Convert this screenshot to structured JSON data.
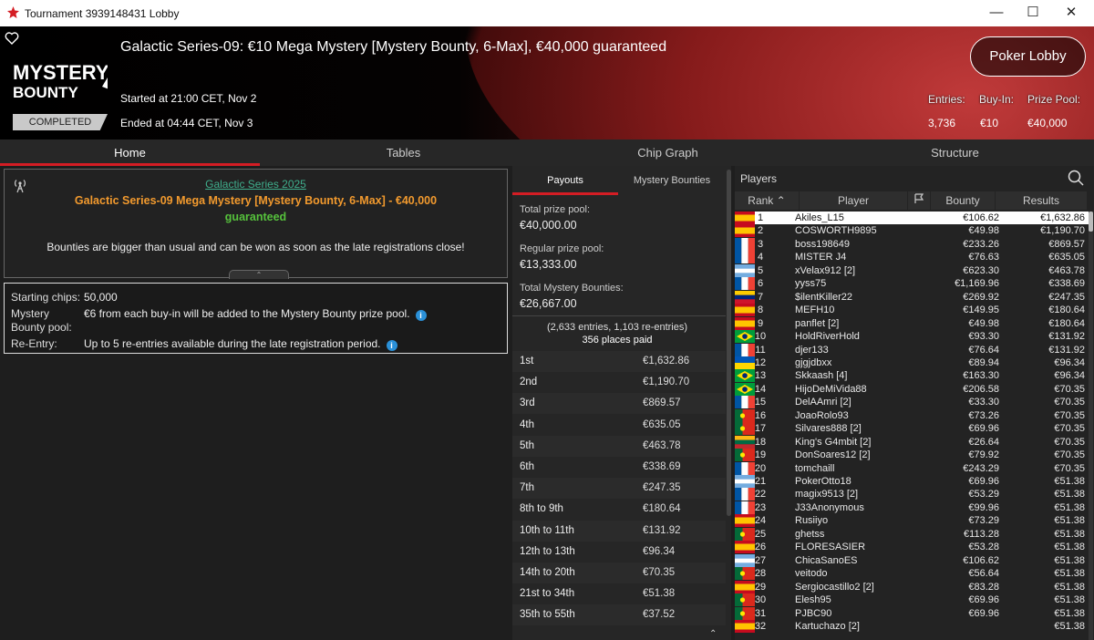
{
  "window": {
    "title": "Tournament 3939148431 Lobby"
  },
  "header": {
    "tournament_title": "Galactic Series-09: €10 Mega Mystery [Mystery Bounty, 6-Max], €40,000 guaranteed",
    "started": "Started at 21:00 CET, Nov 2",
    "ended": "Ended at 04:44 CET, Nov 3",
    "status_badge": "COMPLETED",
    "logo_text_top": "MYSTERY",
    "logo_text_bottom": "BOUNTY",
    "lobby_button": "Poker Lobby",
    "stats": {
      "entries_label": "Entries:",
      "buyin_label": "Buy-In:",
      "prize_label": "Prize Pool:",
      "entries": "3,736",
      "buyin": "€10",
      "prize": "€40,000"
    }
  },
  "tabs": [
    "Home",
    "Tables",
    "Chip Graph",
    "Structure"
  ],
  "info": {
    "series_link": "Galactic Series 2025",
    "name_orange": "Galactic Series-09 Mega Mystery [Mystery Bounty, 6-Max]",
    "name_sep": " - ",
    "name_green_1": "€40,000",
    "name_green_2": "guaranteed",
    "description": "Bounties are bigger than usual and can be won as soon as the late registrations close!"
  },
  "details": {
    "starting_chips_label": "Starting chips:",
    "starting_chips": "50,000",
    "mystery_label_1": "Mystery",
    "mystery_label_2": "Bounty pool:",
    "mystery_value": "€6 from each buy-in will be added to the Mystery Bounty prize pool.",
    "reentry_label": "Re-Entry:",
    "reentry_value": "Up to 5 re-entries available during the late registration period."
  },
  "payouts": {
    "tabs": [
      "Payouts",
      "Mystery Bounties"
    ],
    "total_label": "Total prize pool:",
    "total": "€40,000.00",
    "regular_label": "Regular prize pool:",
    "regular": "€13,333.00",
    "mystery_label": "Total Mystery Bounties:",
    "mystery": "€26,667.00",
    "entries_line": "(2,633 entries, 1,103 re-entries)",
    "places_line": "356 places paid",
    "rows": [
      {
        "place": "1st",
        "amount": "€1,632.86"
      },
      {
        "place": "2nd",
        "amount": "€1,190.70"
      },
      {
        "place": "3rd",
        "amount": "€869.57"
      },
      {
        "place": "4th",
        "amount": "€635.05"
      },
      {
        "place": "5th",
        "amount": "€463.78"
      },
      {
        "place": "6th",
        "amount": "€338.69"
      },
      {
        "place": "7th",
        "amount": "€247.35"
      },
      {
        "place": "8th to 9th",
        "amount": "€180.64"
      },
      {
        "place": "10th to 11th",
        "amount": "€131.92"
      },
      {
        "place": "12th to 13th",
        "amount": "€96.34"
      },
      {
        "place": "14th to 20th",
        "amount": "€70.35"
      },
      {
        "place": "21st to 34th",
        "amount": "€51.38"
      },
      {
        "place": "35th to 55th",
        "amount": "€37.52"
      }
    ]
  },
  "players": {
    "title": "Players",
    "headers": {
      "rank": "Rank",
      "player": "Player",
      "bounty": "Bounty",
      "results": "Results"
    },
    "rows": [
      {
        "rank": "1",
        "name": "Akiles_L15",
        "flag": "es",
        "bounty": "€106.62",
        "result": "€1,632.86"
      },
      {
        "rank": "2",
        "name": "COSWORTH9895",
        "flag": "es",
        "bounty": "€49.98",
        "result": "€1,190.70"
      },
      {
        "rank": "3",
        "name": "boss198649",
        "flag": "fr",
        "bounty": "€233.26",
        "result": "€869.57"
      },
      {
        "rank": "4",
        "name": "MISTER J4",
        "flag": "fr",
        "bounty": "€76.63",
        "result": "€635.05"
      },
      {
        "rank": "5",
        "name": "xVelax912 [2]",
        "flag": "ar",
        "bounty": "€623.30",
        "result": "€463.78"
      },
      {
        "rank": "6",
        "name": "yyss75",
        "flag": "fr",
        "bounty": "€1,169.96",
        "result": "€338.69"
      },
      {
        "rank": "7",
        "name": "$ilentKiller22",
        "flag": "ve",
        "bounty": "€269.92",
        "result": "€247.35"
      },
      {
        "rank": "8",
        "name": "MEFH10",
        "flag": "es",
        "bounty": "€149.95",
        "result": "€180.64"
      },
      {
        "rank": "9",
        "name": "panflet [2]",
        "flag": "es",
        "bounty": "€49.98",
        "result": "€180.64"
      },
      {
        "rank": "10",
        "name": "HoldRiverHold",
        "flag": "br",
        "bounty": "€93.30",
        "result": "€131.92"
      },
      {
        "rank": "11",
        "name": "djer133",
        "flag": "fr",
        "bounty": "€76.64",
        "result": "€131.92"
      },
      {
        "rank": "12",
        "name": "gjgjdbxx",
        "flag": "ua",
        "bounty": "€89.94",
        "result": "€96.34"
      },
      {
        "rank": "13",
        "name": "Skkaash [4]",
        "flag": "br",
        "bounty": "€163.30",
        "result": "€96.34"
      },
      {
        "rank": "14",
        "name": "HijoDeMiVida88",
        "flag": "br",
        "bounty": "€206.58",
        "result": "€70.35"
      },
      {
        "rank": "15",
        "name": "DelAAmri [2]",
        "flag": "fr",
        "bounty": "€33.30",
        "result": "€70.35"
      },
      {
        "rank": "16",
        "name": "JoaoRolo93",
        "flag": "pt",
        "bounty": "€73.26",
        "result": "€70.35"
      },
      {
        "rank": "17",
        "name": "Silvares888 [2]",
        "flag": "pt",
        "bounty": "€69.96",
        "result": "€70.35"
      },
      {
        "rank": "18",
        "name": "King's G4mbit [2]",
        "flag": "lt",
        "bounty": "€26.64",
        "result": "€70.35"
      },
      {
        "rank": "19",
        "name": "DonSoares12 [2]",
        "flag": "pt",
        "bounty": "€79.92",
        "result": "€70.35"
      },
      {
        "rank": "20",
        "name": "tomchaill",
        "flag": "fr",
        "bounty": "€243.29",
        "result": "€70.35"
      },
      {
        "rank": "21",
        "name": "PokerOtto18",
        "flag": "ar",
        "bounty": "€69.96",
        "result": "€51.38"
      },
      {
        "rank": "22",
        "name": "magix9513 [2]",
        "flag": "fr",
        "bounty": "€53.29",
        "result": "€51.38"
      },
      {
        "rank": "23",
        "name": "J33Anonymous",
        "flag": "fr",
        "bounty": "€99.96",
        "result": "€51.38"
      },
      {
        "rank": "24",
        "name": "Rusiiyo",
        "flag": "es",
        "bounty": "€73.29",
        "result": "€51.38"
      },
      {
        "rank": "25",
        "name": "ghetss",
        "flag": "pt",
        "bounty": "€113.28",
        "result": "€51.38"
      },
      {
        "rank": "26",
        "name": "FLORESASIER",
        "flag": "es",
        "bounty": "€53.28",
        "result": "€51.38"
      },
      {
        "rank": "27",
        "name": "ChicaSanoES",
        "flag": "ar",
        "bounty": "€106.62",
        "result": "€51.38"
      },
      {
        "rank": "28",
        "name": "veitodo",
        "flag": "pt",
        "bounty": "€56.64",
        "result": "€51.38"
      },
      {
        "rank": "29",
        "name": "Sergiocastillo2 [2]",
        "flag": "es",
        "bounty": "€83.28",
        "result": "€51.38"
      },
      {
        "rank": "30",
        "name": "Elesh95",
        "flag": "pt",
        "bounty": "€69.96",
        "result": "€51.38"
      },
      {
        "rank": "31",
        "name": "PJBC90",
        "flag": "pt",
        "bounty": "€69.96",
        "result": "€51.38"
      },
      {
        "rank": "32",
        "name": "Kartuchazo [2]",
        "flag": "es",
        "bounty": "",
        "result": "€51.38"
      }
    ]
  },
  "colors": {
    "accent": "#d41d24",
    "link": "#3fae8c",
    "orange": "#f29a2e",
    "green": "#56c23c"
  }
}
